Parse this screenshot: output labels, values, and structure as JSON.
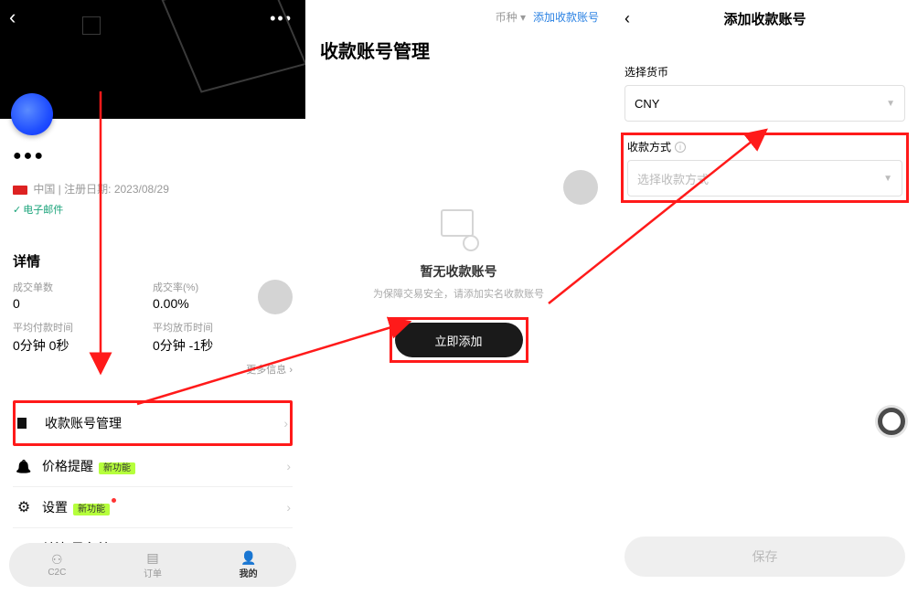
{
  "panel1": {
    "username": "●●●",
    "region_prefix": "中国 | 注册日期:",
    "register_date": "2023/08/29",
    "email_badge": "电子邮件",
    "details_title": "详情",
    "stats": {
      "trade_count_label": "成交单数",
      "trade_count_value": "0",
      "rate_label": "成交率(%)",
      "rate_value": "0.00%",
      "avg_pay_label": "平均付款时间",
      "avg_pay_value": "0分钟 0秒",
      "avg_release_label": "平均放币时间",
      "avg_release_value": "0分钟 -1秒"
    },
    "more_info": "更多信息",
    "menu": {
      "payment": "收款账号管理",
      "price_alert": "价格提醒",
      "settings": "设置",
      "blacklist": "关注/黑名单",
      "new_badge": "新功能"
    },
    "nav": {
      "c2c": "C2C",
      "orders": "订单",
      "mine": "我的"
    }
  },
  "panel2": {
    "currency_label": "币种",
    "add_link": "添加收款账号",
    "title": "收款账号管理",
    "empty_title": "暂无收款账号",
    "empty_sub": "为保障交易安全，请添加实名收款账号",
    "button": "立即添加"
  },
  "panel3": {
    "title": "添加收款账号",
    "currency_label": "选择货币",
    "currency_value": "CNY",
    "method_label": "收款方式",
    "method_placeholder": "选择收款方式",
    "save": "保存"
  }
}
